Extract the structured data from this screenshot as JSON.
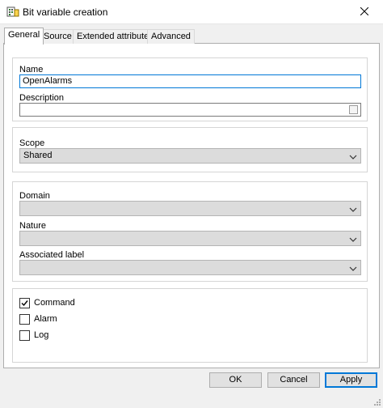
{
  "window": {
    "title": "Bit variable creation",
    "icon": "bit-variable-app-icon",
    "close_icon": "close-icon"
  },
  "tabs": [
    {
      "label": "General",
      "active": true
    },
    {
      "label": "Source",
      "active": false
    },
    {
      "label": "Extended attributes",
      "active": false
    },
    {
      "label": "Advanced",
      "active": false
    }
  ],
  "identity": {
    "name_label": "Name",
    "name_value": "OpenAlarms",
    "description_label": "Description",
    "description_value": ""
  },
  "scope": {
    "label": "Scope",
    "selected": "Shared"
  },
  "classification": {
    "domain_label": "Domain",
    "domain_value": "",
    "nature_label": "Nature",
    "nature_value": "",
    "associated_label_label": "Associated label",
    "associated_label_value": ""
  },
  "options": [
    {
      "label": "Command",
      "checked": true
    },
    {
      "label": "Alarm",
      "checked": false
    },
    {
      "label": "Log",
      "checked": false
    }
  ],
  "buttons": {
    "ok": "OK",
    "cancel": "Cancel",
    "apply": "Apply"
  },
  "colors": {
    "focus_accent": "#0078d7",
    "combo_background": "#dcdcdc",
    "dialog_background": "#f0f0f0"
  }
}
